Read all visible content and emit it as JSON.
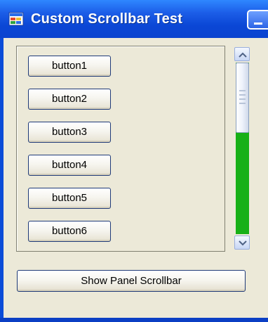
{
  "window": {
    "title": "Custom Scrollbar Test"
  },
  "panel": {
    "buttons": [
      {
        "label": "button1"
      },
      {
        "label": "button2"
      },
      {
        "label": "button3"
      },
      {
        "label": "button4"
      },
      {
        "label": "button5"
      },
      {
        "label": "button6"
      }
    ]
  },
  "scrollbar": {
    "track_color": "#17b017",
    "up_arrow_icon": "chevron-up-icon",
    "down_arrow_icon": "chevron-down-icon"
  },
  "footer": {
    "show_scrollbar_label": "Show Panel Scrollbar"
  }
}
